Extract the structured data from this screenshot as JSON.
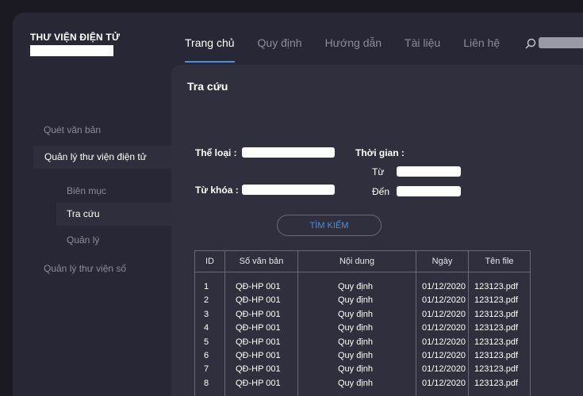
{
  "app": {
    "title": "THƯ VIỆN ĐIỆN TỬ"
  },
  "topnav": [
    {
      "label": "Trang chủ",
      "active": true
    },
    {
      "label": "Quy định"
    },
    {
      "label": "Hướng dẫn"
    },
    {
      "label": "Tài liệu"
    },
    {
      "label": "Liên hệ"
    }
  ],
  "sidebar": {
    "items": [
      {
        "label": "Quét văn bản"
      },
      {
        "label": "Quản lý thư viện điện tử",
        "expanded": true
      },
      {
        "label": "Biên mục"
      },
      {
        "label": "Tra cứu",
        "active": true
      },
      {
        "label": "Quản lý"
      },
      {
        "label": "Quản lý thư viện số"
      }
    ]
  },
  "main": {
    "title": "Tra cứu",
    "form": {
      "category_label": "Thể loại :",
      "keyword_label": "Từ khóa :",
      "time_label": "Thời gian :",
      "from_label": "Từ",
      "to_label": "Đến",
      "category_value": "",
      "keyword_value": "",
      "from_value": "",
      "to_value": ""
    },
    "search_button": "TÌM KIẾM",
    "table": {
      "headers": [
        "ID",
        "Số văn bản",
        "Nội dung",
        "Ngày",
        "Tên file"
      ],
      "rows": [
        [
          "1",
          "QĐ-HP 001",
          "Quy định",
          "01/12/2020",
          "123123.pdf"
        ],
        [
          "2",
          "QĐ-HP 001",
          "Quy định",
          "01/12/2020",
          "123123.pdf"
        ],
        [
          "3",
          "QĐ-HP 001",
          "Quy định",
          "01/12/2020",
          "123123.pdf"
        ],
        [
          "4",
          "QĐ-HP 001",
          "Quy định",
          "01/12/2020",
          "123123.pdf"
        ],
        [
          "5",
          "QĐ-HP 001",
          "Quy định",
          "01/12/2020",
          "123123.pdf"
        ],
        [
          "6",
          "QĐ-HP 001",
          "Quy định",
          "01/12/2020",
          "123123.pdf"
        ],
        [
          "7",
          "QĐ-HP 001",
          "Quy định",
          "01/12/2020",
          "123123.pdf"
        ],
        [
          "8",
          "QĐ-HP 001",
          "Quy định",
          "01/12/2020",
          "123123.pdf"
        ]
      ]
    }
  },
  "colors": {
    "accent": "#4a8fe0",
    "background": "#282735",
    "panel": "#302f3d"
  }
}
